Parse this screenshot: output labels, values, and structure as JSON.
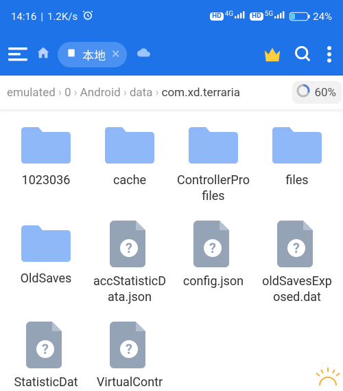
{
  "status": {
    "time": "14:16",
    "speed": "1.2K/s",
    "battery_pct": "24%",
    "hd_badge": "HD",
    "net1_label": "4G",
    "net2_label": "5G"
  },
  "actionbar": {
    "chip_label": "本地"
  },
  "breadcrumb": {
    "items": [
      "emulated",
      "0",
      "Android",
      "data",
      "com.xd.terraria"
    ],
    "storage_pct": "60%"
  },
  "grid": {
    "items": [
      {
        "type": "folder",
        "name": "1023036"
      },
      {
        "type": "folder",
        "name": "cache"
      },
      {
        "type": "folder",
        "name": "ControllerProfiles"
      },
      {
        "type": "folder",
        "name": "files"
      },
      {
        "type": "folder",
        "name": "OldSaves"
      },
      {
        "type": "file",
        "name": "accStatisticData.json"
      },
      {
        "type": "file",
        "name": "config.json"
      },
      {
        "type": "file",
        "name": "oldSavesExposed.dat"
      },
      {
        "type": "file",
        "name": "StatisticDat"
      },
      {
        "type": "file",
        "name": "VirtualContr"
      }
    ]
  }
}
